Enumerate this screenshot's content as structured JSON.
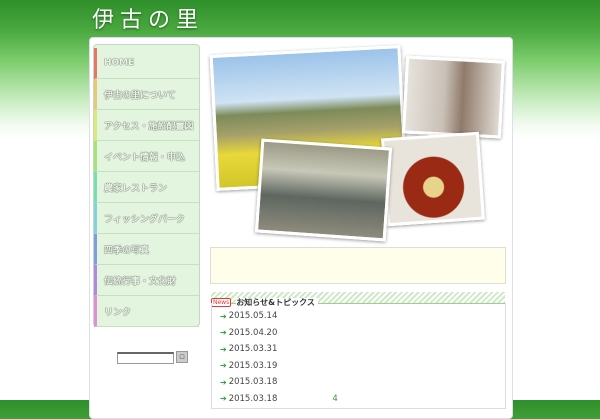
{
  "header": {
    "logo": "伊古の里"
  },
  "nav": {
    "items": [
      {
        "label": "HOME",
        "color": "#e2776a"
      },
      {
        "label": "伊古の里について",
        "color": "#e6c878"
      },
      {
        "label": "アクセス・施設配置図",
        "color": "#dbe87a"
      },
      {
        "label": "イベント情報・申込",
        "color": "#a6e27a"
      },
      {
        "label": "農家レストラン",
        "color": "#79dcb9"
      },
      {
        "label": "フィッシングパーク",
        "color": "#86cfe0"
      },
      {
        "label": "四季の写真",
        "color": "#7f9ee0"
      },
      {
        "label": "伝統行事・文化財",
        "color": "#b287e0"
      },
      {
        "label": "リンク",
        "color": "#e08ed8"
      }
    ]
  },
  "search": {
    "value": "",
    "button": "□"
  },
  "news": {
    "badge": "News",
    "title": "お知らせ&トピックス",
    "items": [
      {
        "date": "2015.05.14",
        "extra": ""
      },
      {
        "date": "2015.04.20",
        "extra": ""
      },
      {
        "date": "2015.03.31",
        "extra": ""
      },
      {
        "date": "2015.03.19",
        "extra": ""
      },
      {
        "date": "2015.03.18",
        "extra": ""
      },
      {
        "date": "2015.03.18",
        "extra": "4"
      }
    ]
  }
}
